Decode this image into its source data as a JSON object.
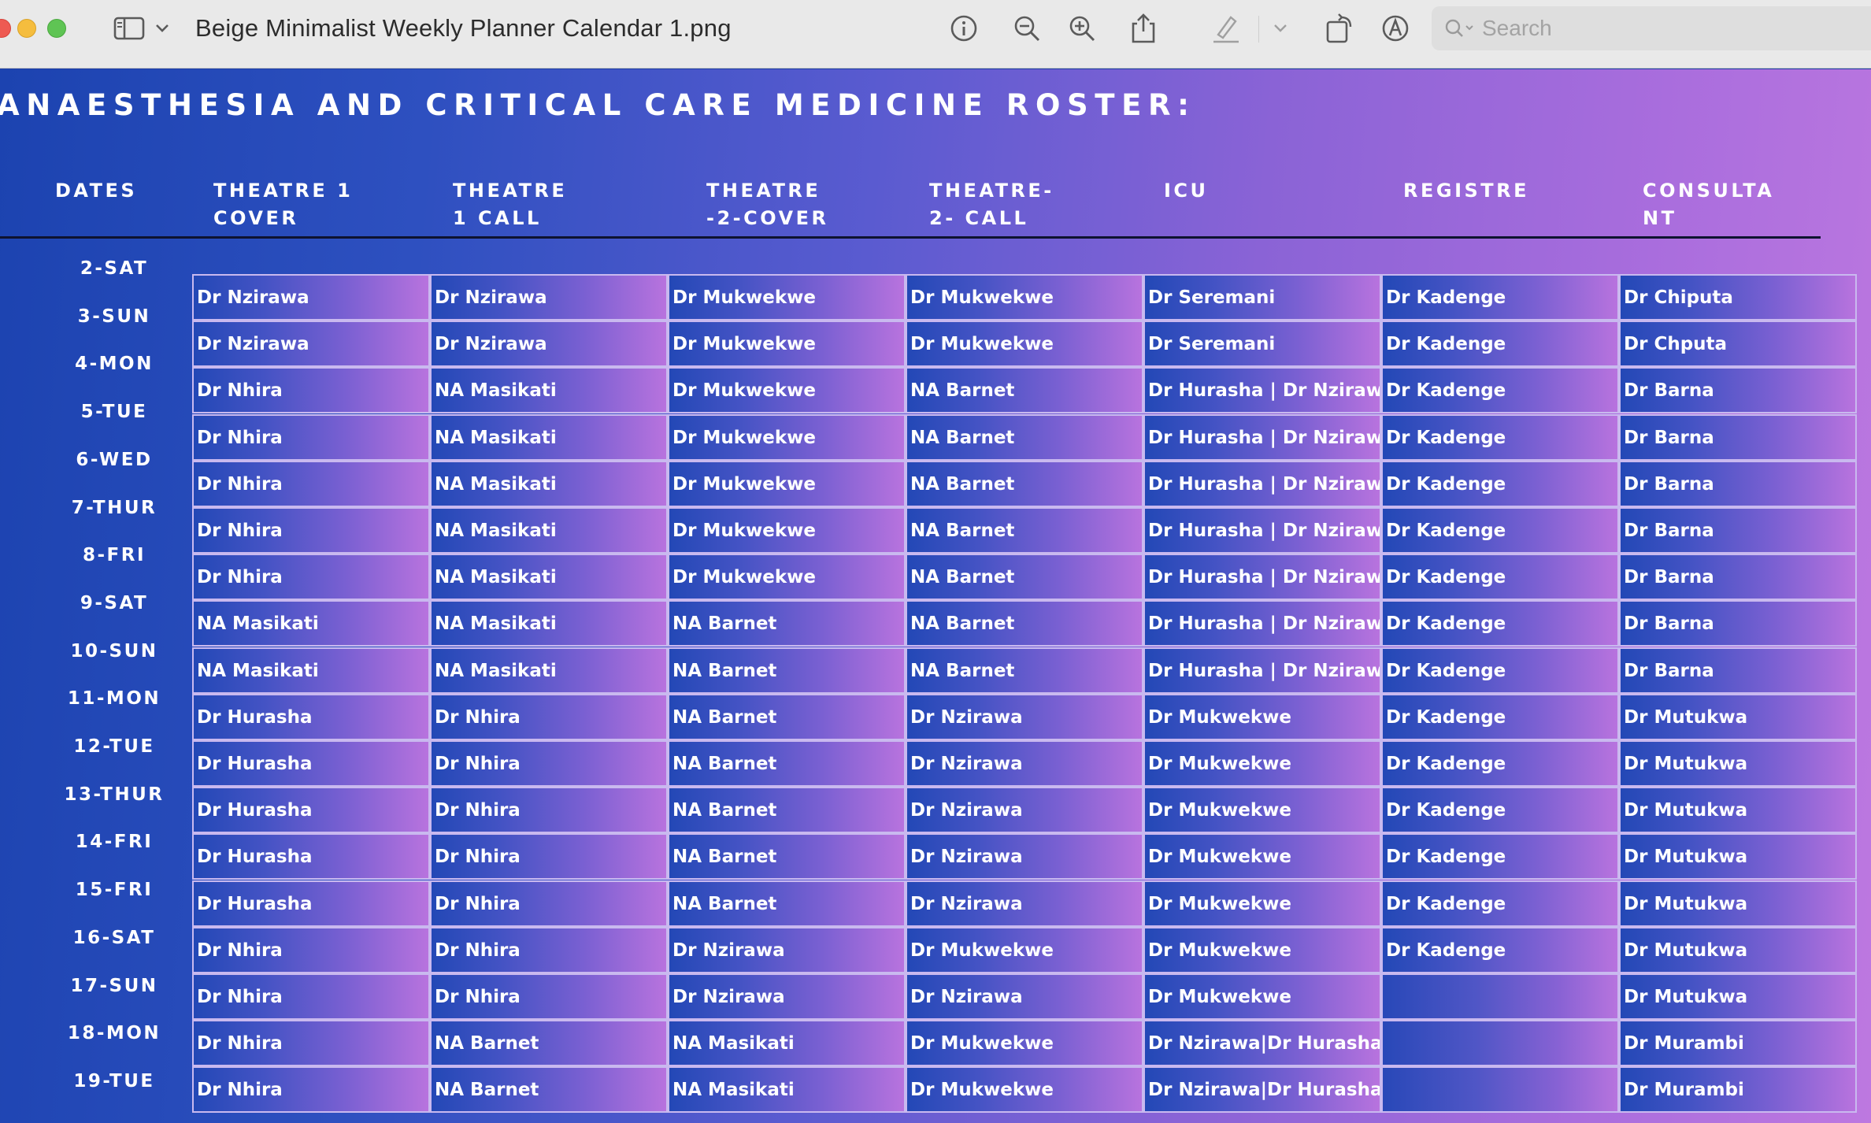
{
  "window": {
    "title": "Beige Minimalist Weekly Planner Calendar 1.png",
    "search_placeholder": "Search"
  },
  "toolbar": {
    "icons": [
      "sidebar-icon",
      "chevron-down-icon",
      "info-icon",
      "zoom-out-icon",
      "zoom-in-icon",
      "share-icon",
      "highlight-icon",
      "chevron-down-icon",
      "rotate-icon",
      "markup-icon",
      "search-icon"
    ]
  },
  "roster": {
    "title": "ANAESTHESIA AND CRITICAL CARE MEDICINE ROSTER:",
    "columns": [
      "DATES",
      "THEATRE 1\nCOVER",
      "THEATRE\n1 CALL",
      "THEATRE\n-2-COVER",
      "THEATRE-\n2- CALL",
      "ICU",
      "REGISTRE",
      "CONSULTA\nNT"
    ],
    "rows": [
      {
        "date": "2-SAT",
        "cells": [
          "Dr Nzirawa",
          "Dr Nzirawa",
          "Dr Mukwekwe",
          "Dr Mukwekwe",
          "Dr Seremani",
          "Dr Kadenge",
          "Dr Chiputa"
        ]
      },
      {
        "date": "3-SUN",
        "cells": [
          "Dr Nzirawa",
          "Dr Nzirawa",
          "Dr Mukwekwe",
          "Dr Mukwekwe",
          "Dr Seremani",
          "Dr Kadenge",
          "Dr Chputa"
        ]
      },
      {
        "date": "4-MON",
        "cells": [
          "Dr Nhira",
          "NA Masikati",
          "Dr Mukwekwe",
          "NA Barnet",
          "Dr Hurasha | Dr Nzirawa",
          "Dr Kadenge",
          "Dr Barna"
        ]
      },
      {
        "date": "5-TUE",
        "cells": [
          "Dr Nhira",
          "NA Masikati",
          "Dr Mukwekwe",
          "NA Barnet",
          "Dr Hurasha | Dr Nzirawa",
          "Dr Kadenge",
          "Dr Barna"
        ]
      },
      {
        "date": "6-WED",
        "cells": [
          "Dr Nhira",
          "NA Masikati",
          "Dr Mukwekwe",
          "NA Barnet",
          "Dr Hurasha | Dr Nzirawa",
          "Dr Kadenge",
          "Dr Barna"
        ]
      },
      {
        "date": "7-THUR",
        "cells": [
          "Dr Nhira",
          "NA Masikati",
          "Dr Mukwekwe",
          "NA Barnet",
          "Dr Hurasha | Dr Nzirawa",
          "Dr Kadenge",
          "Dr Barna"
        ]
      },
      {
        "date": "8-FRI",
        "cells": [
          "Dr Nhira",
          "NA Masikati",
          "Dr Mukwekwe",
          "NA Barnet",
          "Dr Hurasha | Dr Nzirawa",
          "Dr Kadenge",
          "Dr Barna"
        ]
      },
      {
        "date": "9-SAT",
        "cells": [
          "NA Masikati",
          "NA Masikati",
          "NA Barnet",
          "NA Barnet",
          "Dr Hurasha | Dr Nzirawa",
          "Dr Kadenge",
          "Dr Barna"
        ]
      },
      {
        "date": "10-SUN",
        "cells": [
          "NA Masikati",
          "NA Masikati",
          "NA Barnet",
          "NA Barnet",
          "Dr Hurasha | Dr Nzirawa",
          "Dr Kadenge",
          "Dr Barna"
        ]
      },
      {
        "date": "11-MON",
        "cells": [
          "Dr Hurasha",
          "Dr Nhira",
          "NA Barnet",
          "Dr Nzirawa",
          "Dr Mukwekwe",
          "Dr Kadenge",
          "Dr Mutukwa"
        ]
      },
      {
        "date": "12-TUE",
        "cells": [
          "Dr Hurasha",
          "Dr Nhira",
          "NA Barnet",
          "Dr Nzirawa",
          "Dr Mukwekwe",
          "Dr Kadenge",
          "Dr Mutukwa"
        ]
      },
      {
        "date": "13-THUR",
        "cells": [
          "Dr Hurasha",
          "Dr Nhira",
          "NA Barnet",
          "Dr Nzirawa",
          "Dr Mukwekwe",
          "Dr Kadenge",
          "Dr Mutukwa"
        ]
      },
      {
        "date": "14-FRI",
        "cells": [
          "Dr Hurasha",
          "Dr Nhira",
          "NA Barnet",
          "Dr Nzirawa",
          "Dr Mukwekwe",
          "Dr Kadenge",
          "Dr Mutukwa"
        ]
      },
      {
        "date": "15-FRI",
        "cells": [
          "Dr Hurasha",
          "Dr Nhira",
          "NA Barnet",
          "Dr Nzirawa",
          "Dr Mukwekwe",
          "Dr Kadenge",
          "Dr Mutukwa"
        ]
      },
      {
        "date": "16-SAT",
        "cells": [
          "Dr Nhira",
          "Dr Nhira",
          "Dr Nzirawa",
          "Dr Mukwekwe",
          "Dr Mukwekwe",
          "Dr Kadenge",
          "Dr Mutukwa"
        ]
      },
      {
        "date": "17-SUN",
        "cells": [
          "Dr Nhira",
          "Dr Nhira",
          "Dr Nzirawa",
          "Dr Nzirawa",
          "Dr Mukwekwe",
          "",
          "Dr Mutukwa"
        ]
      },
      {
        "date": "18-MON",
        "cells": [
          "Dr Nhira",
          "NA Barnet",
          "NA Masikati",
          "Dr Mukwekwe",
          "Dr Nzirawa|Dr Hurasha",
          "",
          "Dr Murambi"
        ]
      },
      {
        "date": "19-TUE",
        "cells": [
          "Dr Nhira",
          "NA Barnet",
          "NA Masikati",
          "Dr Mukwekwe",
          "Dr Nzirawa|Dr Hurasha",
          "",
          "Dr Murambi"
        ]
      }
    ]
  }
}
